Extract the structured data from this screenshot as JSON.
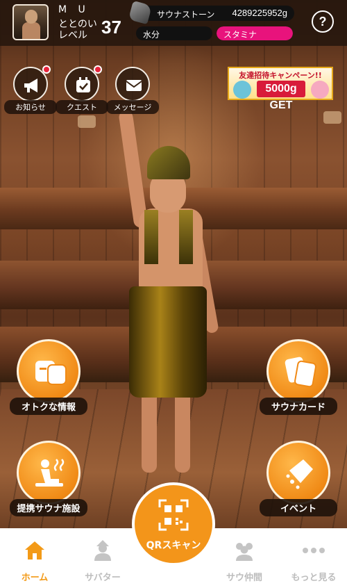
{
  "header": {
    "user_name": "M U",
    "level_label_line1": "ととのい",
    "level_label_line2": "レベル",
    "level_value": "37",
    "stone_label": "サウナストーン",
    "stone_value": "4289225952g",
    "water_label": "水分",
    "water_level": 0,
    "stamina_label": "スタミナ",
    "stamina_level": 1.0,
    "help_symbol": "?"
  },
  "top_buttons": [
    {
      "label": "お知らせ",
      "icon": "megaphone-icon",
      "badge": true
    },
    {
      "label": "クエスト",
      "icon": "calendar-check-icon",
      "badge": true
    },
    {
      "label": "メッセージ",
      "icon": "envelope-icon",
      "badge": false
    }
  ],
  "banner": {
    "title": "友達招待キャンペーン!!",
    "amount": "5000g GET"
  },
  "side_buttons": [
    {
      "label": "オトクな情報",
      "icon": "ticket-icon"
    },
    {
      "label": "サウナカード",
      "icon": "cards-icon"
    },
    {
      "label": "提携サウナ施設",
      "icon": "sauna-person-icon"
    },
    {
      "label": "イベント",
      "icon": "party-popper-icon"
    }
  ],
  "bottom_nav": [
    {
      "label": "ホーム",
      "icon": "home-icon",
      "active": true
    },
    {
      "label": "サバター",
      "icon": "avatar-icon",
      "active": false
    },
    {
      "label": "サウ仲間",
      "icon": "friends-icon",
      "active": false
    },
    {
      "label": "もっと見る",
      "icon": "more-icon",
      "active": false
    }
  ],
  "qr": {
    "label": "QRスキャン",
    "icon": "qr-scan-icon"
  },
  "colors": {
    "accent_orange": "#f3951a",
    "stamina_pink": "#e8137c",
    "badge_red": "#e8243b",
    "inactive_gray": "#bdbdbd"
  }
}
